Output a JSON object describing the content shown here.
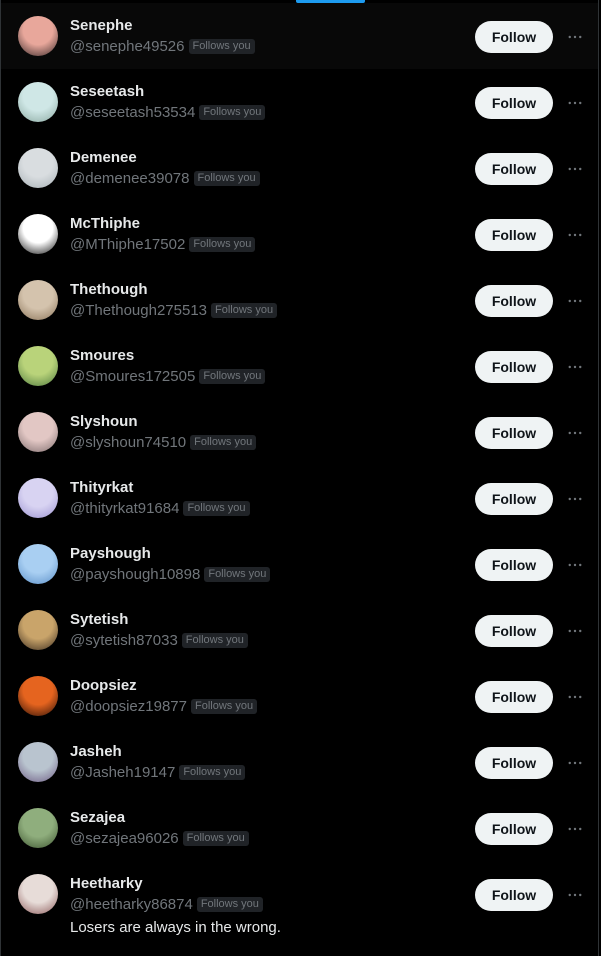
{
  "follow_label": "Follow",
  "badge_label": "Follows you",
  "accent_color": "#1d9bf0",
  "more_icon": "more-horizontal-icon",
  "accounts": [
    {
      "name": "Senephe",
      "handle": "@senephe49526",
      "avatar": [
        "#e8a79b",
        "#3a2a2a"
      ]
    },
    {
      "name": "Seseetash",
      "handle": "@seseetash53534",
      "avatar": [
        "#cfe7e6",
        "#8aa8a0"
      ]
    },
    {
      "name": "Demenee",
      "handle": "@demenee39078",
      "avatar": [
        "#d9dde0",
        "#a7b0b5"
      ]
    },
    {
      "name": "McThiphe",
      "handle": "@MThiphe17502",
      "avatar": [
        "#ffffff",
        "#111111"
      ]
    },
    {
      "name": "Thethough",
      "handle": "@Thethough275513",
      "avatar": [
        "#d4c3ad",
        "#8a7358"
      ]
    },
    {
      "name": "Smoures",
      "handle": "@Smoures172505",
      "avatar": [
        "#b9d37a",
        "#4e7a3e"
      ]
    },
    {
      "name": "Slyshoun",
      "handle": "@slyshoun74510",
      "avatar": [
        "#e2c7c4",
        "#7c6b6c"
      ]
    },
    {
      "name": "Thityrkat",
      "handle": "@thityrkat91684",
      "avatar": [
        "#d8d3f2",
        "#9c93d1"
      ]
    },
    {
      "name": "Payshough",
      "handle": "@payshough10898",
      "avatar": [
        "#a9cff2",
        "#5b8fc8"
      ]
    },
    {
      "name": "Sytetish",
      "handle": "@sytetish87033",
      "avatar": [
        "#c9a46a",
        "#3b2c1f"
      ]
    },
    {
      "name": "Doopsiez",
      "handle": "@doopsiez19877",
      "avatar": [
        "#e5641f",
        "#2a0f06"
      ]
    },
    {
      "name": "Jasheh",
      "handle": "@Jasheh19147",
      "avatar": [
        "#b9c4cf",
        "#6d5b83"
      ]
    },
    {
      "name": "Sezajea",
      "handle": "@sezajea96026",
      "avatar": [
        "#8fae7d",
        "#3d5430"
      ]
    },
    {
      "name": "Heetharky",
      "handle": "@heetharky86874",
      "avatar": [
        "#e7dcd8",
        "#8c5b5b"
      ],
      "bio": "Losers are always in the wrong."
    }
  ]
}
